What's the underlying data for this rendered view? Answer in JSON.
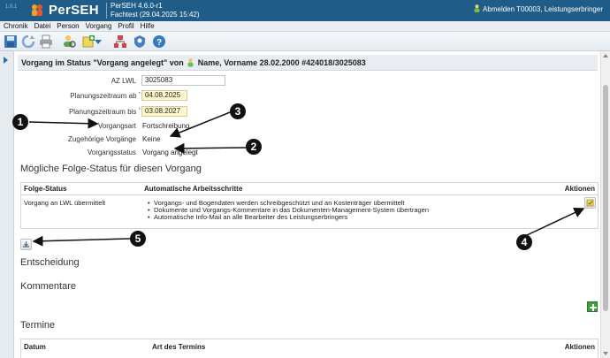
{
  "titlebar": {
    "logo_text": "PerSEH",
    "version_small": "1.0.1",
    "app_version": "PerSEH 4.6.0-r1",
    "app_env": "Fachtest (29.04.2025 15:42)",
    "logout_label": "Abmelden T00003, Leistungserbringer"
  },
  "menu": [
    "Chronik",
    "Datei",
    "Person",
    "Vorgang",
    "Profil",
    "Hilfe"
  ],
  "toolbar": {
    "icons": [
      "save-icon",
      "refresh-icon",
      "print-icon",
      "person-search-icon",
      "new-dropdown-icon",
      "network-icon",
      "badge-icon",
      "help-icon"
    ]
  },
  "header": {
    "prefix": "Vorgang im Status \"Vorgang angelegt\" von",
    "suffix": "Name, Vorname 28.02.2000 #424018/3025083"
  },
  "form": {
    "az_label": "AZ LWL",
    "az_value": "3025083",
    "pz_ab_label": "Planungszeitraum ab",
    "pz_ab_value": "04.08.2025",
    "pz_bis_label": "Planungszeitraum bis",
    "pz_bis_value": "03.08.2027",
    "req_marker": "*",
    "vorgangsart_label": "Vorgangsart",
    "vorgangsart_value": "Fortschreibung",
    "zug_label": "Zugehörige Vorgänge",
    "zug_value": "Keine",
    "status_label": "Vorgangsstatus",
    "status_value": "Vorgang angelegt"
  },
  "folge": {
    "title": "Mögliche Folge-Status für diesen Vorgang",
    "headers": [
      "Folge-Status",
      "Automatische Arbeitsschritte",
      "Aktionen"
    ],
    "row_status": "Vorgang an LWL übermittelt",
    "steps": [
      "Vorgangs- und Bogendaten werden schreibgeschützt und an Kostenträger übermittelt",
      "Dokumente und Vorgangs-Kommentare in das Dokumenten-Management-System übertragen",
      "Automatische Info-Mail an alle Bearbeiter des Leistungserbringers"
    ]
  },
  "sections": {
    "entscheidung": "Entscheidung",
    "kommentare": "Kommentare",
    "termine": "Termine"
  },
  "termine_table": {
    "headers": [
      "Datum",
      "Art des Termins",
      "Aktionen"
    ]
  },
  "callouts": [
    "1",
    "2",
    "3",
    "4",
    "5"
  ],
  "colors": {
    "titlebar": "#1f5d88",
    "accent": "#2a6db0",
    "required_field": "#fdf7cf",
    "add_green": "#3aa13a"
  }
}
